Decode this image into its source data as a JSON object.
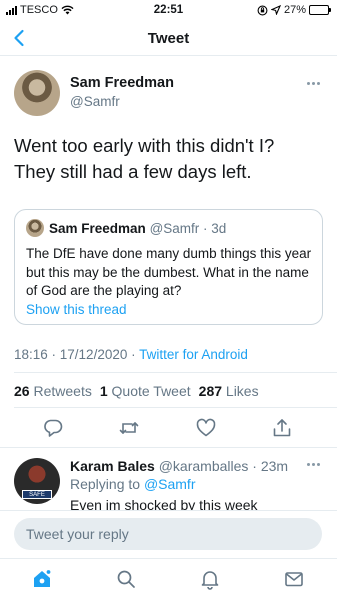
{
  "status_bar": {
    "carrier": "TESCO",
    "time": "22:51",
    "battery": "27%",
    "battery_level": 0.27
  },
  "nav": {
    "title": "Tweet",
    "back_icon": "chevron-left-icon"
  },
  "tweet": {
    "author_name": "Sam Freedman",
    "author_handle": "@Samfr",
    "text_lines": [
      "Went too early with this didn't I?",
      "They still had a few days left."
    ],
    "quote": {
      "author_name": "Sam Freedman",
      "author_meta": "@Samfr · 3d",
      "text": "The DfE have done many dumb things this year but this may be the dumbest. What in the name of God are the playing at?",
      "show_thread": "Show this thread"
    },
    "timestamp": "18:16 · 17/12/2020 · ",
    "source": "Twitter for Android",
    "stats": {
      "retweets_count": "26",
      "retweets_label": "Retweets",
      "quotes_count": "1",
      "quotes_label": "Quote Tweet",
      "likes_count": "287",
      "likes_label": "Likes"
    }
  },
  "reply": {
    "author_name": "Karam Bales",
    "author_meta": "@karamballes · 23m",
    "replying_prefix": "Replying to ",
    "replying_to": "@Samfr",
    "text": "Even im shocked by this week",
    "badge_text": "SAFE"
  },
  "composer": {
    "placeholder": "Tweet your reply"
  },
  "colors": {
    "accent": "#1da1f2",
    "muted": "#657786",
    "divider": "#e6ecf0"
  },
  "tabs": [
    "home-icon",
    "search-icon",
    "notifications-icon",
    "messages-icon"
  ]
}
